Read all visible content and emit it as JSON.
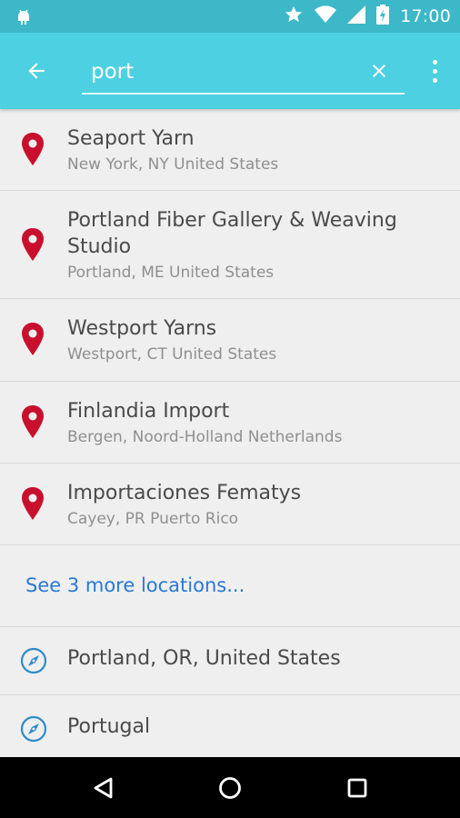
{
  "status_bar": {
    "time": "17:00",
    "icons": [
      "android-icon",
      "star-icon",
      "wifi-icon",
      "signal-icon",
      "battery-charging-icon"
    ]
  },
  "app_bar": {
    "search_value": "port",
    "back_icon": "back-arrow-icon",
    "clear_icon": "close-icon",
    "menu_icon": "more-vert-icon",
    "background_color": "#4dd0e1"
  },
  "results": [
    {
      "title": "Seaport Yarn",
      "subtitle": "New York, NY United States"
    },
    {
      "title": "Portland Fiber Gallery & Weaving Studio",
      "subtitle": "Portland, ME United States"
    },
    {
      "title": "Westport Yarns",
      "subtitle": "Westport, CT United States"
    },
    {
      "title": "Finlandia Import",
      "subtitle": "Bergen, Noord-Holland Netherlands"
    },
    {
      "title": "Importaciones Fematys",
      "subtitle": "Cayey, PR Puerto Rico"
    }
  ],
  "more_link": {
    "label": "See 3 more locations...",
    "color": "#2979d3"
  },
  "places": [
    {
      "title": "Portland, OR, United States"
    },
    {
      "title": "Portugal"
    }
  ],
  "colors": {
    "pin": "#c8102e",
    "compass": "#2e8bc9",
    "status_bar": "#3cb8c9"
  },
  "nav_bar": {
    "icons": [
      "back-triangle-icon",
      "home-circle-icon",
      "recents-square-icon"
    ]
  }
}
